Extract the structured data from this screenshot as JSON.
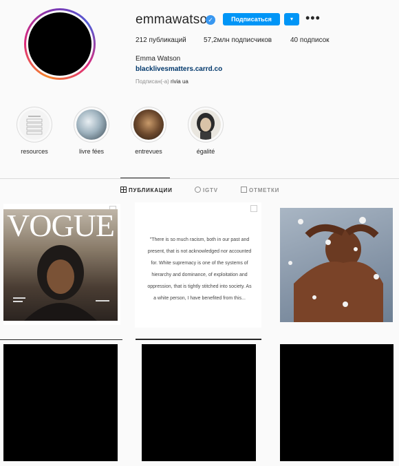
{
  "profile": {
    "username": "emmawatson",
    "verified_icon": "✓",
    "follow_label": "Подписаться",
    "dropdown_icon": "▾",
    "more_icon": "•••",
    "stats": {
      "posts": "212 публикаций",
      "followers": "57,2млн подписчиков",
      "following": "40 подписок"
    },
    "full_name": "Emma Watson",
    "bio_link": "blacklivesmatters.carrd.co",
    "followed_by_prefix": "Подписан(-а)",
    "followed_by_user": "rivia ua"
  },
  "highlights": [
    {
      "label": "resources"
    },
    {
      "label": "livre fées"
    },
    {
      "label": "entrevues"
    },
    {
      "label": "égalité"
    }
  ],
  "tabs": [
    {
      "label": "ПУБЛИКАЦИИ",
      "icon": "grid-icon",
      "active": true
    },
    {
      "label": "IGTV",
      "icon": "tv-icon",
      "active": false
    },
    {
      "label": "ОТМЕТКИ",
      "icon": "tag-icon",
      "active": false
    }
  ],
  "posts": {
    "vogue_title": "VOGUE",
    "quote": "\"There is so much racism, both in our past and present, that is not acknowledged nor accounted for. White supremacy is one of the systems of hierarchy and dominance, of exploitation and oppression, that is tightly stitched into society. As a white person, I have benefited from this..."
  },
  "colors": {
    "accent": "#0095f6",
    "link": "#00376b",
    "background": "#fafafa"
  }
}
